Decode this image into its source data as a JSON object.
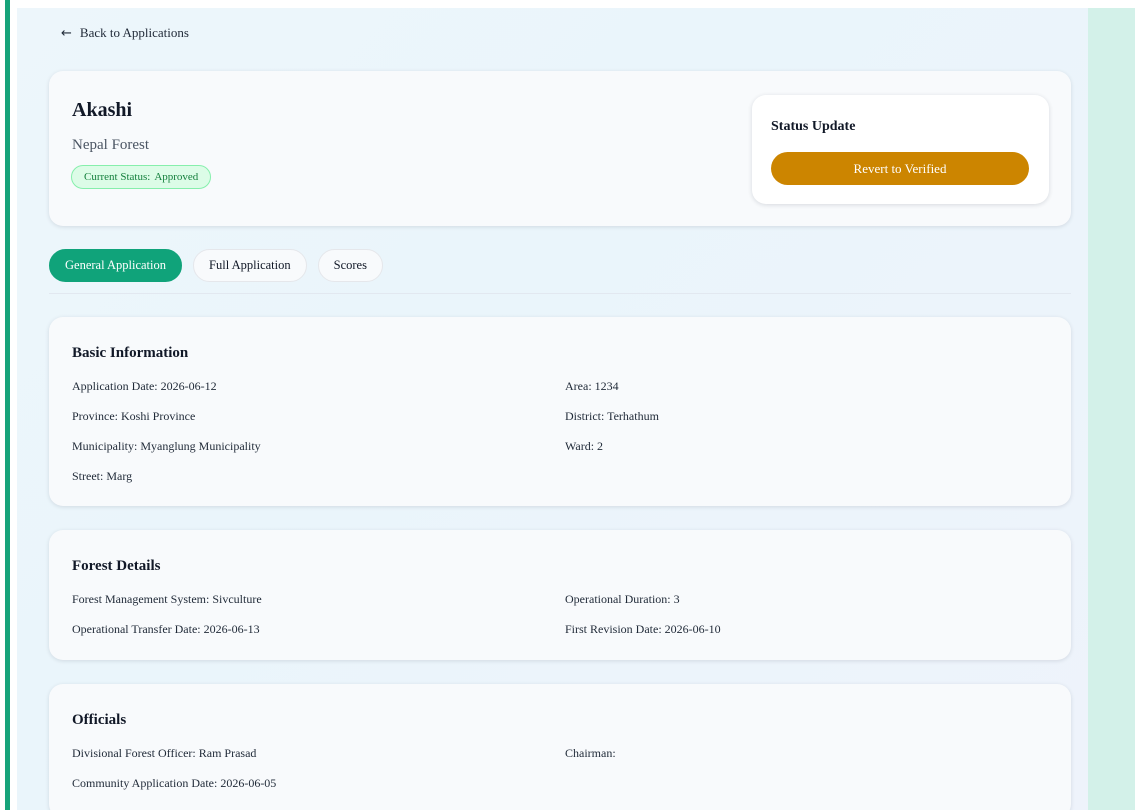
{
  "nav": {
    "back_label": "Back to Applications",
    "back_icon": "arrow-left-icon"
  },
  "header": {
    "name": "Akashi",
    "forest": "Nepal Forest",
    "status_label": "Current Status:",
    "status_value": "Approved"
  },
  "status_update": {
    "title": "Status Update",
    "button_label": "Revert to Verified",
    "button_color": "#cc8500"
  },
  "tabs": [
    {
      "label": "General Application",
      "active": true
    },
    {
      "label": "Full Application",
      "active": false
    },
    {
      "label": "Scores",
      "active": false
    }
  ],
  "basic_info": {
    "title": "Basic Information",
    "fields": [
      "Application Date: 2026-06-12",
      "Area: 1234",
      "Province: Koshi Province",
      "District: Terhathum",
      "Municipality: Myanglung Municipality",
      "Ward: 2",
      "Street: Marg"
    ]
  },
  "forest_details": {
    "title": "Forest Details",
    "fields": [
      "Forest Management System: Sivculture",
      "Operational Duration: 3",
      "Operational Transfer Date: 2026-06-13",
      "First Revision Date: 2026-06-10"
    ]
  },
  "officials": {
    "title": "Officials",
    "fields": [
      "Divisional Forest Officer: Ram Prasad",
      "Chairman:",
      "Community Application Date: 2026-06-05"
    ]
  },
  "colors": {
    "accent": "#10a37a",
    "status_bg": "#dcfce7",
    "status_text": "#15803d"
  }
}
